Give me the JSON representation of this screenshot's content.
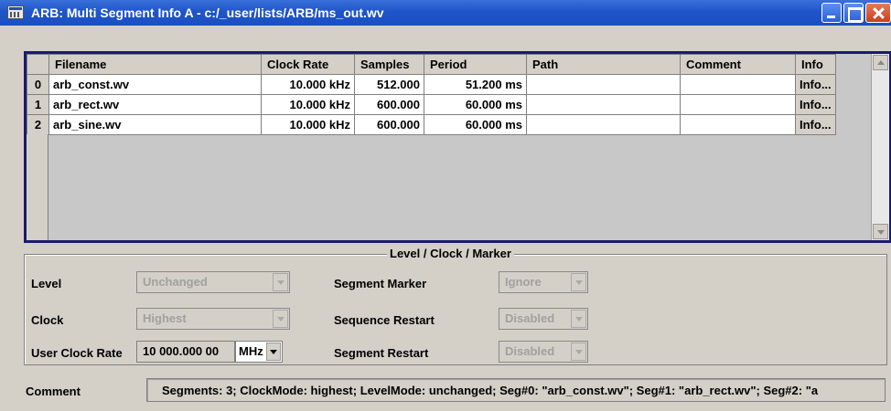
{
  "window": {
    "title": "ARB: Multi Segment Info A - c:/_user/lists/ARB/ms_out.wv"
  },
  "table": {
    "columns": [
      "Filename",
      "Clock Rate",
      "Samples",
      "Period",
      "Path",
      "Comment",
      "Info"
    ],
    "rows": [
      {
        "index": "0",
        "filename": "arb_const.wv",
        "clock": "10.000  kHz",
        "samples": "512.000",
        "period": "51.200  ms",
        "path": "",
        "comment": "",
        "info": "Info..."
      },
      {
        "index": "1",
        "filename": "arb_rect.wv",
        "clock": "10.000  kHz",
        "samples": "600.000",
        "period": "60.000  ms",
        "path": "",
        "comment": "",
        "info": "Info..."
      },
      {
        "index": "2",
        "filename": "arb_sine.wv",
        "clock": "10.000  kHz",
        "samples": "600.000",
        "period": "60.000  ms",
        "path": "",
        "comment": "",
        "info": "Info..."
      }
    ]
  },
  "group": {
    "title": "Level / Clock / Marker",
    "level_label": "Level",
    "level_value": "Unchanged",
    "clock_label": "Clock",
    "clock_value": "Highest",
    "user_clock_label": "User Clock Rate",
    "user_clock_value": "10 000.000 00",
    "user_clock_unit": "MHz",
    "segment_marker_label": "Segment Marker",
    "segment_marker_value": "Ignore",
    "sequence_restart_label": "Sequence Restart",
    "sequence_restart_value": "Disabled",
    "segment_restart_label": "Segment Restart",
    "segment_restart_value": "Disabled"
  },
  "comment": {
    "label": "Comment",
    "value": "Segments: 3; ClockMode: highest; LevelMode: unchanged; Seg#0: \"arb_const.wv\"; Seg#1: \"arb_rect.wv\"; Seg#2: \"a"
  },
  "colors": {
    "titlebar": "#1f55c9",
    "table_border": "#1a1a6e",
    "panel": "#d4d0c8"
  },
  "icons": [
    "app-icon",
    "minimize-icon",
    "maximize-icon",
    "close-icon",
    "chevron-down-icon",
    "scroll-up-icon",
    "scroll-down-icon"
  ]
}
